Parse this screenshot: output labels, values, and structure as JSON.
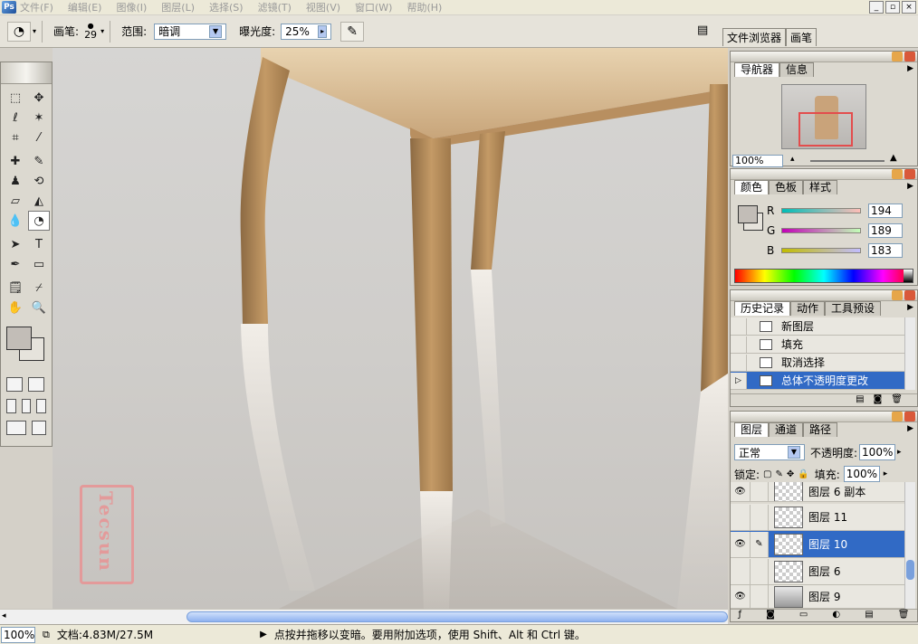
{
  "menu": [
    "文件(F)",
    "编辑(E)",
    "图像(I)",
    "图层(L)",
    "选择(S)",
    "滤镜(T)",
    "视图(V)",
    "窗口(W)",
    "帮助(H)"
  ],
  "options": {
    "brush_label": "画笔:",
    "brush_size": "29",
    "range_label": "范围:",
    "range_value": "暗调",
    "exposure_label": "曝光度:",
    "exposure_value": "25%"
  },
  "top_tabs": [
    "文件浏览器",
    "画笔"
  ],
  "stamp_text": "Tecsun",
  "navigator": {
    "tabs": [
      "导航器",
      "信息"
    ],
    "zoom": "100%"
  },
  "color": {
    "tabs": [
      "颜色",
      "色板",
      "样式"
    ],
    "r_label": "R",
    "g_label": "G",
    "b_label": "B",
    "r": "194",
    "g": "189",
    "b": "183",
    "accent": "#c2bdb7"
  },
  "history": {
    "tabs": [
      "历史记录",
      "动作",
      "工具预设"
    ],
    "items": [
      "新图层",
      "填充",
      "取消选择",
      "总体不透明度更改"
    ]
  },
  "layers": {
    "tabs": [
      "图层",
      "通道",
      "路径"
    ],
    "blend": "正常",
    "opacity_label": "不透明度:",
    "opacity": "100%",
    "lock_label": "锁定:",
    "fill_label": "填充:",
    "fill": "100%",
    "items": [
      "图层 6 副本",
      "图层 11",
      "图层 10",
      "图层 6",
      "图层 9"
    ]
  },
  "status": {
    "zoom": "100%",
    "doc": "文档:4.83M/27.5M",
    "hint": "点按并拖移以变暗。要用附加选项，使用 Shift、Alt 和 Ctrl 键。"
  }
}
